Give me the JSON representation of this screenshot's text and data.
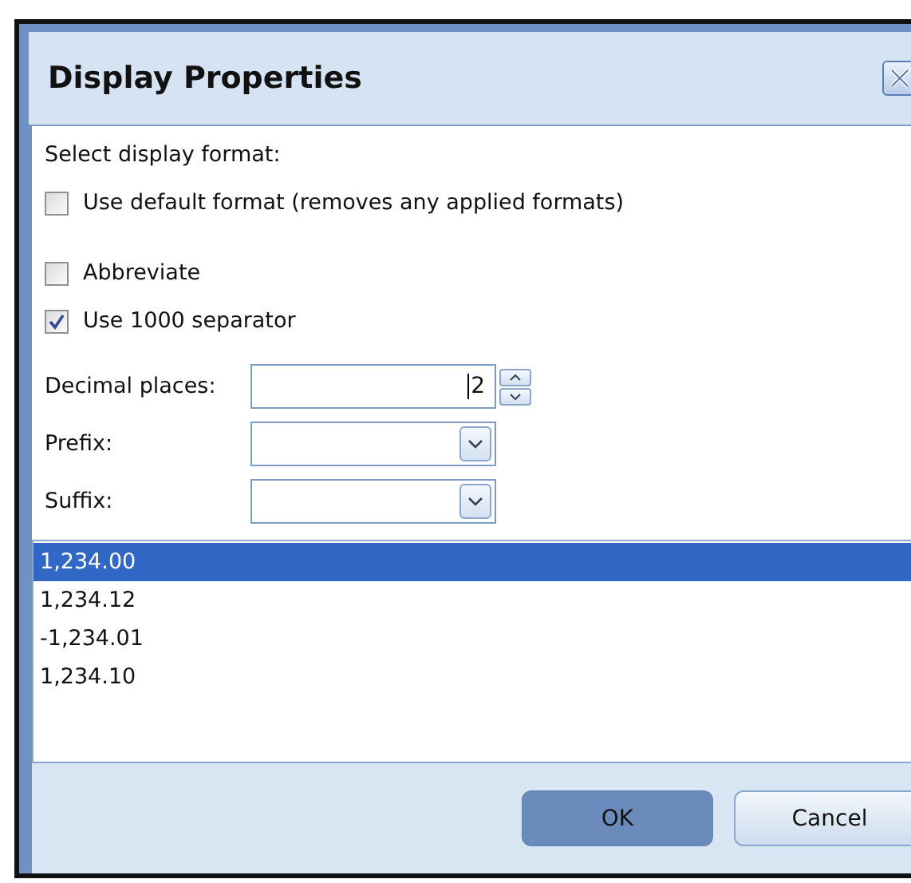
{
  "window": {
    "title": "Display Properties"
  },
  "intro": "Select display format:",
  "checkboxes": [
    {
      "label": "Use default format (removes any applied formats)",
      "checked": false
    },
    {
      "label": "Abbreviate",
      "checked": false
    },
    {
      "label": "Use 1000 separator",
      "checked": true
    }
  ],
  "fields": [
    {
      "label": "Decimal places:",
      "kind": "spinner",
      "value": "2"
    },
    {
      "label": "Prefix:",
      "kind": "dropdown"
    },
    {
      "label": "Suffix:",
      "kind": "dropdown"
    }
  ],
  "preview": [
    {
      "text": "1,234.00",
      "selected": true
    },
    {
      "text": "1,234.12",
      "selected": false
    },
    {
      "text": "-1,234.01",
      "selected": false
    },
    {
      "text": "1,234.10",
      "selected": false
    }
  ],
  "buttons": [
    {
      "label": "OK",
      "default": true
    },
    {
      "label": "Cancel",
      "default": false
    }
  ]
}
